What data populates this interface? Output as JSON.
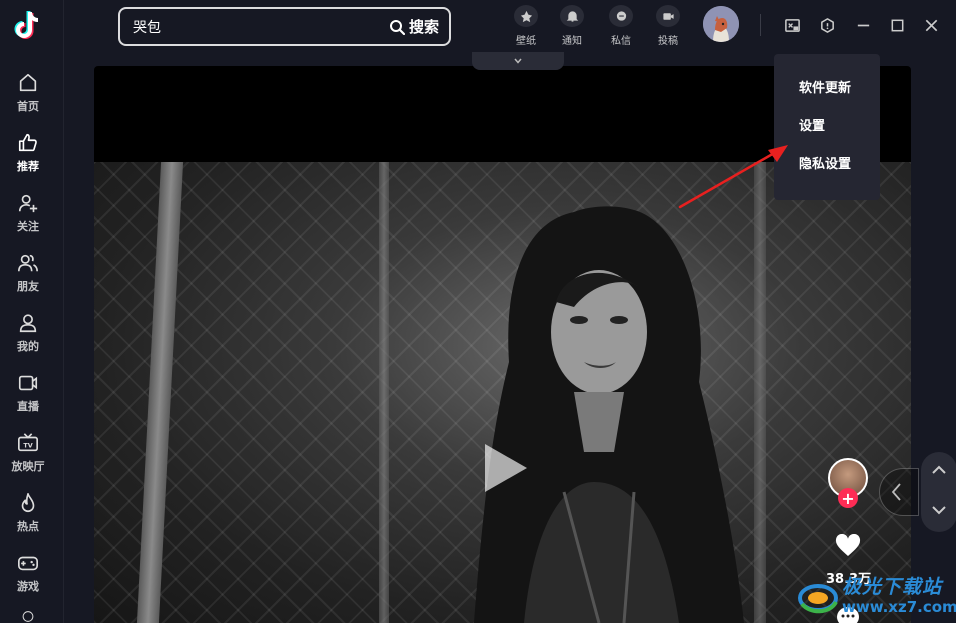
{
  "search": {
    "value": "哭包",
    "button_label": "搜索"
  },
  "top_actions": [
    {
      "label": "壁纸",
      "icon": "wallpaper-icon"
    },
    {
      "label": "通知",
      "icon": "bell-icon"
    },
    {
      "label": "私信",
      "icon": "message-icon"
    },
    {
      "label": "投稿",
      "icon": "upload-video-icon"
    }
  ],
  "sidebar": {
    "items": [
      {
        "label": "首页",
        "icon": "home-icon"
      },
      {
        "label": "推荐",
        "icon": "thumbs-up-icon"
      },
      {
        "label": "关注",
        "icon": "user-plus-icon"
      },
      {
        "label": "朋友",
        "icon": "friends-icon"
      },
      {
        "label": "我的",
        "icon": "user-icon"
      },
      {
        "label": "直播",
        "icon": "live-icon"
      },
      {
        "label": "放映厅",
        "icon": "tv-icon"
      },
      {
        "label": "热点",
        "icon": "flame-icon"
      },
      {
        "label": "游戏",
        "icon": "gamepad-icon"
      }
    ],
    "active_index": 1
  },
  "menu": {
    "items": [
      "软件更新",
      "设置",
      "隐私设置"
    ]
  },
  "video": {
    "like_count": "38.3万"
  },
  "watermark": {
    "line1": "极光下载站",
    "line2": "www.xz7.com"
  },
  "colors": {
    "background": "#161823",
    "accent": "#fe2c55",
    "menu_bg": "#252632",
    "annotation": "#e8201f"
  }
}
